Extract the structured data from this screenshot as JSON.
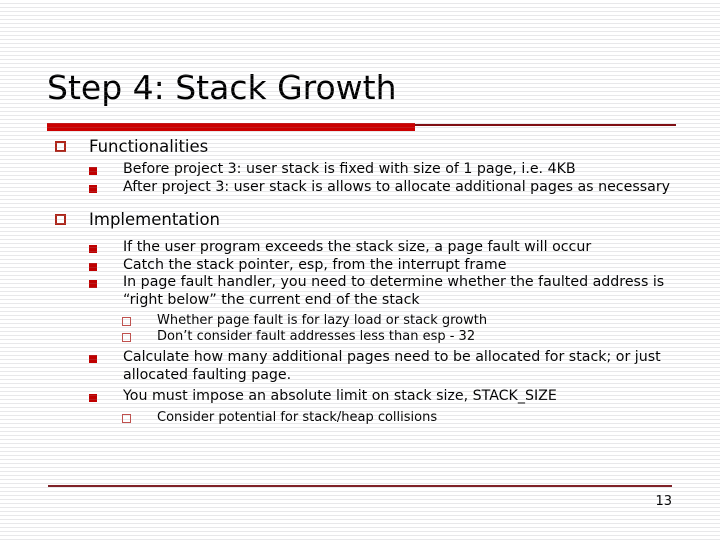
{
  "slide": {
    "title": "Step 4: Stack Growth",
    "page_number": "13",
    "accent_color_thick": "#cc0000",
    "accent_color_thin": "#7f0f13",
    "footer_rule_color": "#7f2228",
    "marker_hollow_color": "#b02418",
    "marker_filled_color": "#c00000",
    "text_color": "#000000",
    "background_color": "#ffffff"
  },
  "sections": [
    {
      "heading": "Functionalities",
      "bullets": [
        "Before project 3: user stack is fixed with size of 1 page, i.e. 4KB",
        "After project 3: user stack is allows to allocate additional pages as necessary"
      ]
    },
    {
      "heading": "Implementation",
      "bullets": [
        "If the user program exceeds the stack size, a page fault will occur",
        "Catch the stack pointer, esp, from the interrupt frame",
        "In page fault handler, you need to determine whether the faulted address is “right below” the current end of the stack",
        "Calculate how many additional pages need to be allocated for stack; or just allocated faulting page.",
        "You must impose an absolute limit on stack size, STACK_SIZE"
      ],
      "sub_bullets_after_3": [
        "Whether page fault is for lazy load or stack growth",
        "Don’t consider fault addresses less than esp - 32"
      ],
      "sub_bullets_after_5": [
        "Consider potential for stack/heap collisions"
      ]
    }
  ]
}
